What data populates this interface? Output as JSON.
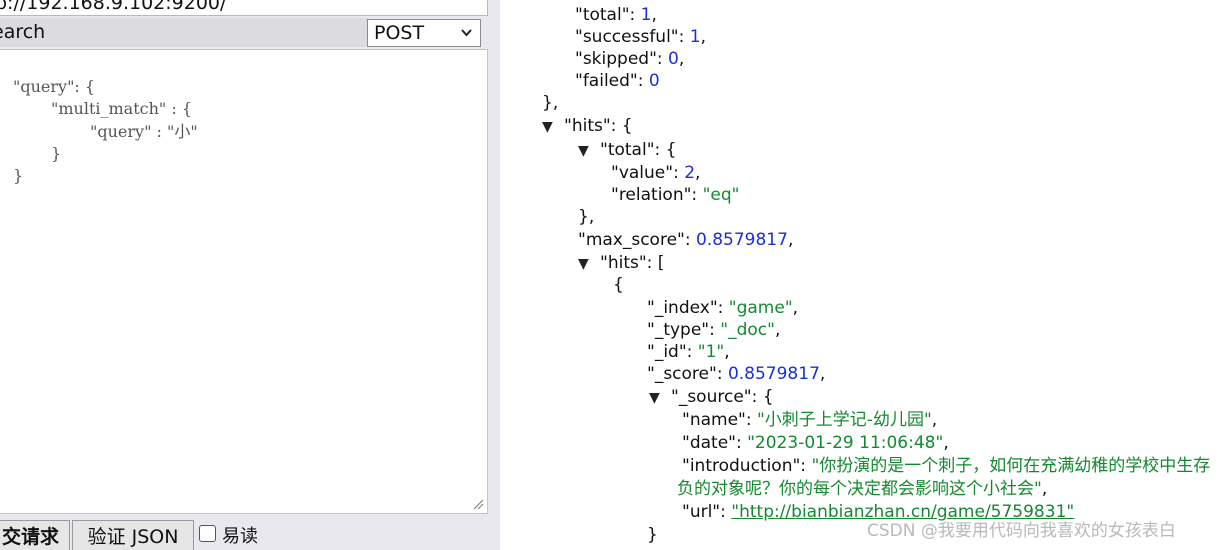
{
  "request": {
    "url": "p://192.168.9.102:9200/",
    "path": "earch",
    "method": "POST",
    "body_lines": [
      "\"query\": {",
      "\"multi_match\" : {",
      "\"query\" : \"小\"",
      "}",
      "}"
    ],
    "submit_label": "交请求",
    "validate_label": "验证 JSON",
    "readable_label": "易读"
  },
  "response": {
    "shards_total": "1",
    "shards_successful": "1",
    "shards_skipped": "0",
    "shards_failed": "0",
    "hits_total_value": "2",
    "hits_total_relation": "\"eq\"",
    "max_score": "0.8579817",
    "hit": {
      "index": "\"game\"",
      "type": "\"_doc\"",
      "id": "\"1\"",
      "score": "0.8579817",
      "source": {
        "name": "\"小刺子上学记-幼儿园\"",
        "date": "\"2023-01-29 11:06:48\"",
        "introduction_1": "\"你扮演的是一个刺子，如何在充满幼稚的学校中生存",
        "introduction_2": "负的对象呢？你的每个决定都会影响这个小社会\"",
        "url": "\"http://bianbianzhan.cn/game/5759831\""
      }
    }
  },
  "icons": {
    "toggle": "triangle-down-icon",
    "select": "chevron-down-icon",
    "grip": "resize-grip-icon"
  },
  "watermark": "CSDN @我要用代码向我喜欢的女孩表白",
  "colors": {
    "string": "#138a2f",
    "number": "#1c2fd6",
    "panel_bg": "#e8e8ee"
  }
}
